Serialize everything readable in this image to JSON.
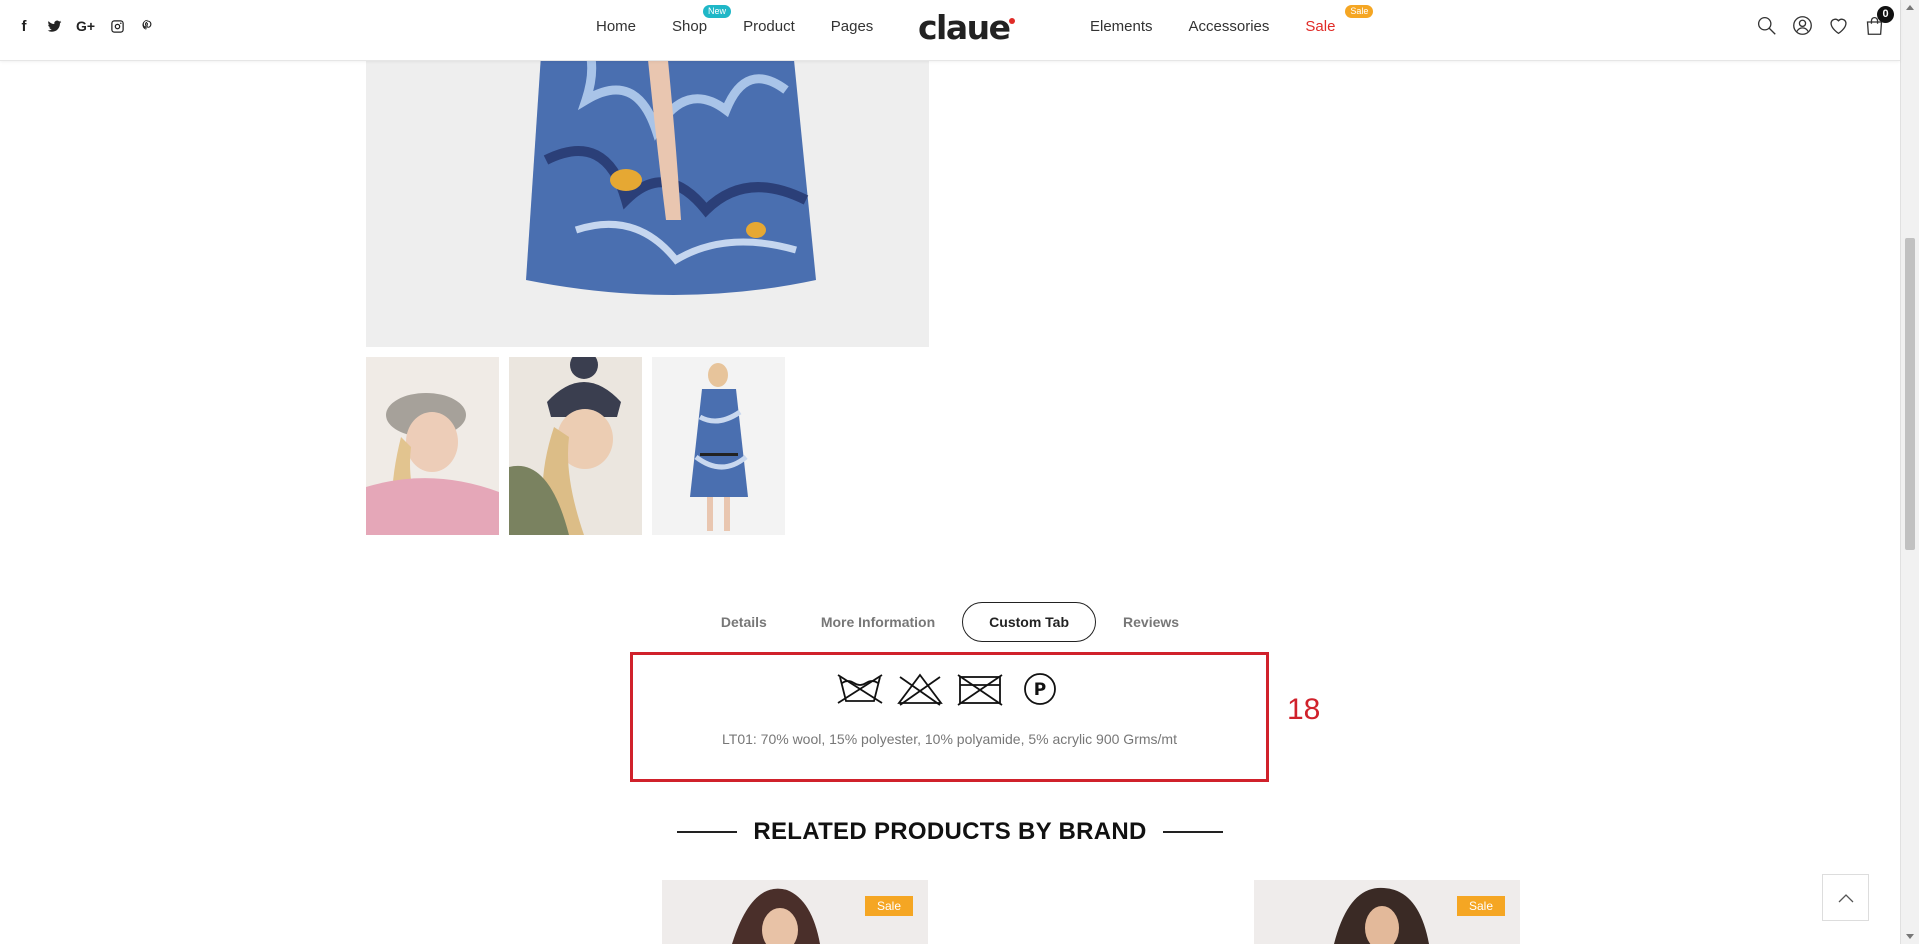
{
  "social": {
    "facebook": "f",
    "googleplus": "G+"
  },
  "nav": {
    "left": [
      {
        "label": "Home"
      },
      {
        "label": "Shop",
        "badge": "New"
      },
      {
        "label": "Product"
      },
      {
        "label": "Pages"
      }
    ],
    "right": [
      {
        "label": "Elements"
      },
      {
        "label": "Accessories"
      },
      {
        "label": "Sale",
        "badge": "Sale"
      }
    ]
  },
  "logo": "claue",
  "cart": {
    "count": "0"
  },
  "tabs": [
    {
      "label": "Details",
      "active": false
    },
    {
      "label": "More Information",
      "active": false
    },
    {
      "label": "Custom Tab",
      "active": true
    },
    {
      "label": "Reviews",
      "active": false
    }
  ],
  "custom_tab": {
    "care_icons": [
      "hand-wash-icon",
      "do-not-bleach-icon",
      "do-not-tumble-dry-icon",
      "dry-clean-p-icon"
    ],
    "care_p_letter": "P",
    "fabric_text": "LT01: 70% wool, 15% polyester, 10% polyamide, 5% acrylic 900 Grms/mt"
  },
  "annotation": "18",
  "related": {
    "heading": "RELATED PRODUCTS BY BRAND",
    "products": [
      {
        "badge": "Sale"
      },
      {
        "badge": "Sale"
      }
    ]
  },
  "colors": {
    "accent_red": "#e02b27",
    "badge_new": "#1fb7c7",
    "badge_sale": "#f5a623",
    "highlight_box": "#d0212b"
  }
}
